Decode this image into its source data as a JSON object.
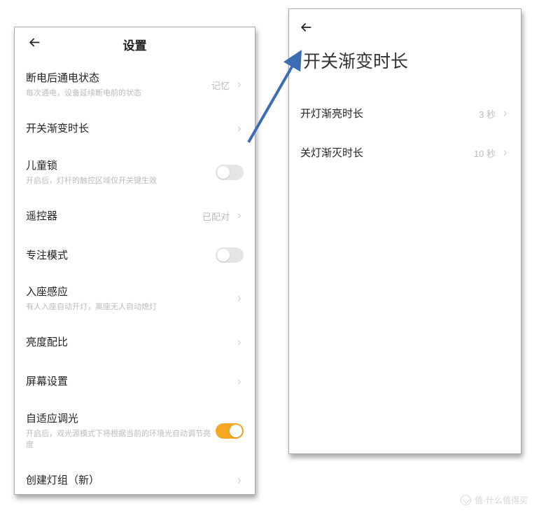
{
  "left": {
    "title": "设置",
    "items": [
      {
        "title": "断电后通电状态",
        "sub": "每次通电，设备延续断电前的状态",
        "value": "记忆",
        "type": "nav"
      },
      {
        "title": "开关渐变时长",
        "sub": "",
        "value": "",
        "type": "nav"
      },
      {
        "title": "儿童锁",
        "sub": "开启后，灯杆的触控区域仅开关键生效",
        "value": "",
        "type": "toggle",
        "on": false
      },
      {
        "title": "遥控器",
        "sub": "",
        "value": "已配对",
        "type": "nav"
      },
      {
        "title": "专注模式",
        "sub": "",
        "value": "",
        "type": "toggle",
        "on": false
      },
      {
        "title": "入座感应",
        "sub": "有人入座自动开灯，离座无人自动熄灯",
        "value": "",
        "type": "nav"
      },
      {
        "title": "亮度配比",
        "sub": "",
        "value": "",
        "type": "nav"
      },
      {
        "title": "屏幕设置",
        "sub": "",
        "value": "",
        "type": "nav"
      },
      {
        "title": "自适应调光",
        "sub": "开启后，双光源模式下将根据当前的环境光自动调节亮度",
        "value": "",
        "type": "toggle",
        "on": true
      },
      {
        "title": "创建灯组（新）",
        "sub": "",
        "value": "",
        "type": "nav"
      }
    ]
  },
  "right": {
    "title": "开关渐变时长",
    "items": [
      {
        "title": "开灯渐亮时长",
        "value": "3 秒"
      },
      {
        "title": "关灯渐灭时长",
        "value": "10 秒"
      }
    ]
  },
  "watermark": "值·什么值得买",
  "colors": {
    "accent": "#f5a623",
    "arrow": "#3b6db5"
  }
}
